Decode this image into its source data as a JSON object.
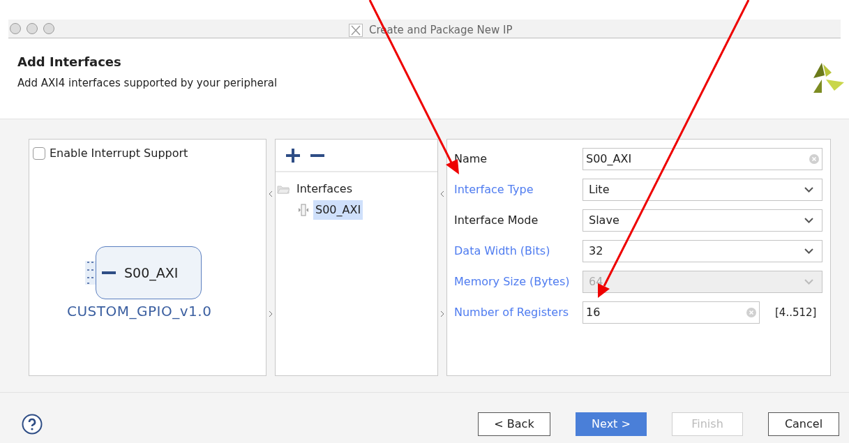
{
  "window": {
    "title": "Create and Package New IP"
  },
  "header": {
    "title": "Add Interfaces",
    "subtitle": "Add AXI4 interfaces supported by your peripheral"
  },
  "interrupt": {
    "label": "Enable Interrupt Support",
    "checked": false
  },
  "block": {
    "port": "S00_AXI",
    "name": "CUSTOM_GPIO_v1.0"
  },
  "tree": {
    "label": "Interfaces",
    "expanded": true,
    "children": [
      {
        "label": "S00_AXI",
        "selected": true
      }
    ]
  },
  "fields": [
    {
      "kind": "text",
      "label": "Name",
      "required": false,
      "value": "S00_AXI",
      "disabled": false
    },
    {
      "kind": "select",
      "label": "Interface Type",
      "required": true,
      "value": "Lite",
      "disabled": false
    },
    {
      "kind": "select",
      "label": "Interface Mode",
      "required": false,
      "value": "Slave",
      "disabled": false
    },
    {
      "kind": "select",
      "label": "Data Width (Bits)",
      "required": true,
      "value": "32",
      "disabled": false
    },
    {
      "kind": "select",
      "label": "Memory Size (Bytes)",
      "required": true,
      "value": "64",
      "disabled": true
    },
    {
      "kind": "text",
      "label": "Number of Registers",
      "required": true,
      "value": "16",
      "disabled": false,
      "range": "[4..512]"
    }
  ],
  "buttons": [
    {
      "label": "< Back",
      "primary": false,
      "disabled": false
    },
    {
      "label": "Next >",
      "primary": true,
      "disabled": false
    },
    {
      "label": "Finish",
      "primary": false,
      "disabled": true
    },
    {
      "label": "Cancel",
      "primary": false,
      "disabled": false
    }
  ]
}
